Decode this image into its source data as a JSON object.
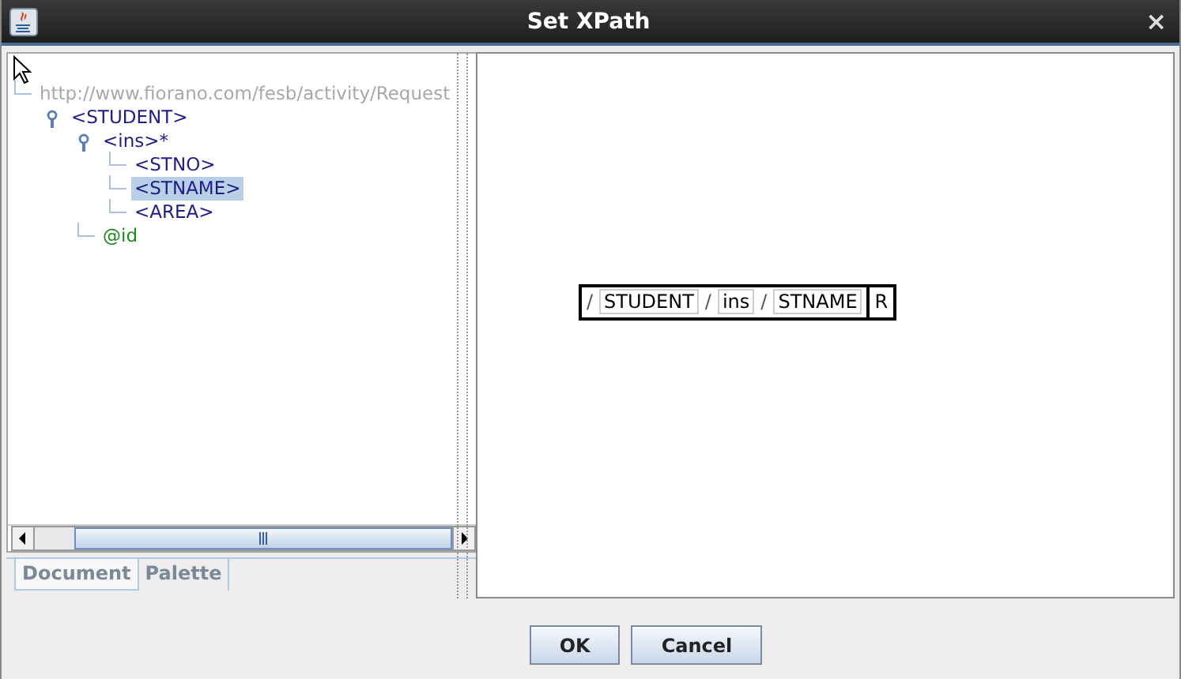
{
  "window": {
    "title": "Set XPath",
    "close": "×"
  },
  "tree": {
    "items": [
      {
        "label": "http://www.fiorano.com/fesb/activity/Request",
        "kind": "namespace",
        "selected": false,
        "children": [
          {
            "label": "<STUDENT>",
            "kind": "element",
            "selected": false,
            "expanded": true,
            "children": [
              {
                "label": "<ins>*",
                "kind": "element",
                "selected": false,
                "expanded": true,
                "children": [
                  {
                    "label": "<STNO>",
                    "kind": "element",
                    "selected": false
                  },
                  {
                    "label": "<STNAME>",
                    "kind": "element",
                    "selected": true
                  },
                  {
                    "label": "<AREA>",
                    "kind": "element",
                    "selected": false
                  }
                ]
              },
              {
                "label": "@id",
                "kind": "attribute",
                "selected": false
              }
            ]
          }
        ]
      }
    ]
  },
  "tabs": [
    {
      "label": "Document",
      "selected": true
    },
    {
      "label": "Palette",
      "selected": false
    }
  ],
  "xpath": {
    "segments": [
      {
        "kind": "separator",
        "text": "/"
      },
      {
        "kind": "step",
        "text": "STUDENT"
      },
      {
        "kind": "separator",
        "text": "/"
      },
      {
        "kind": "step",
        "text": "ins"
      },
      {
        "kind": "separator",
        "text": "/"
      },
      {
        "kind": "step",
        "text": "STNAME"
      }
    ],
    "suffix": "R"
  },
  "buttons": [
    "OK",
    "Cancel"
  ]
}
